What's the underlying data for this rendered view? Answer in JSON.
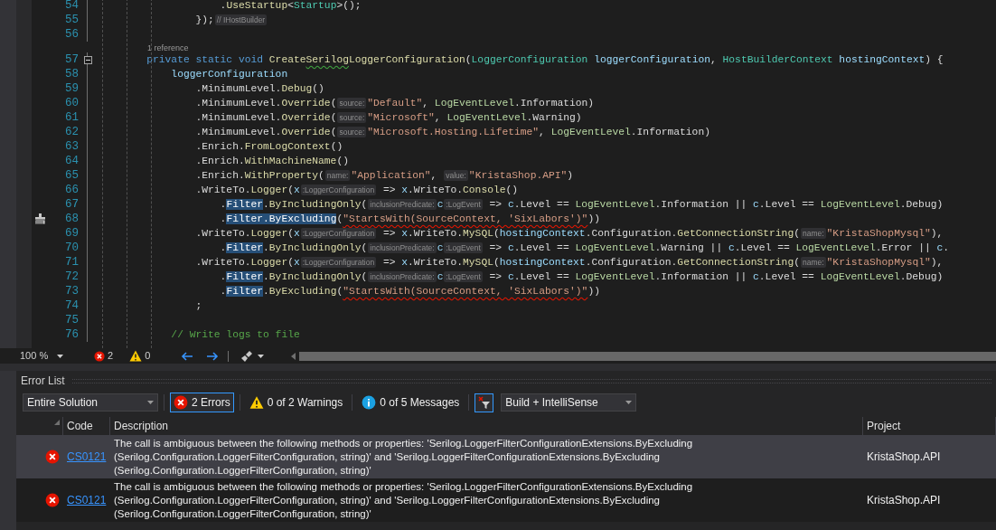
{
  "editor": {
    "lines": [
      {
        "kind": "code",
        "number": "54",
        "fold": false,
        "quick_action": false,
        "tokens": [
          {
            "kind": "plain",
            "text": "                    ."
          },
          {
            "kind": "method",
            "text": "UseStartup"
          },
          {
            "kind": "plain",
            "text": "<"
          },
          {
            "kind": "type",
            "text": "Startup"
          },
          {
            "kind": "plain",
            "text": ">();"
          }
        ]
      },
      {
        "kind": "code",
        "number": "55",
        "fold": false,
        "quick_action": false,
        "tokens": [
          {
            "kind": "plain",
            "text": "                });"
          },
          {
            "kind": "hint",
            "text": "// IHostBuilder"
          }
        ]
      },
      {
        "kind": "code",
        "number": "56",
        "fold": false,
        "quick_action": false
      },
      {
        "kind": "lens",
        "text": "1 reference"
      },
      {
        "kind": "code",
        "number": "57",
        "fold": true,
        "quick_action": false,
        "tokens": [
          {
            "kind": "kw",
            "text": "        private static void "
          },
          {
            "kind": "method",
            "text": "Create"
          },
          {
            "kind": "warning_method",
            "text": "Serilog"
          },
          {
            "kind": "method",
            "text": "LoggerConfiguration"
          },
          {
            "kind": "plain",
            "text": "("
          },
          {
            "kind": "type",
            "text": "LoggerConfiguration"
          },
          {
            "kind": "param",
            "text": " loggerConfiguration"
          },
          {
            "kind": "plain",
            "text": ", "
          },
          {
            "kind": "type",
            "text": "HostBuilderContext"
          },
          {
            "kind": "param",
            "text": " hostingContext"
          },
          {
            "kind": "plain",
            "text": ") {"
          }
        ]
      },
      {
        "kind": "code",
        "number": "58",
        "fold": false,
        "quick_action": false,
        "tokens": [
          {
            "kind": "param",
            "text": "            loggerConfiguration"
          }
        ]
      },
      {
        "kind": "code",
        "number": "59",
        "fold": false,
        "quick_action": false,
        "tokens": [
          {
            "kind": "plain",
            "text": "                .MinimumLevel."
          },
          {
            "kind": "method",
            "text": "Debug"
          },
          {
            "kind": "plain",
            "text": "()"
          }
        ]
      },
      {
        "kind": "code",
        "number": "60",
        "fold": false,
        "quick_action": false,
        "tokens": [
          {
            "kind": "plain",
            "text": "                .MinimumLevel."
          },
          {
            "kind": "method",
            "text": "Override"
          },
          {
            "kind": "plain",
            "text": "("
          },
          {
            "kind": "hint",
            "text": "source:"
          },
          {
            "kind": "str",
            "text": "\"Default\""
          },
          {
            "kind": "plain",
            "text": ", "
          },
          {
            "kind": "enum",
            "text": "LogEventLevel"
          },
          {
            "kind": "plain",
            "text": ".Information)"
          }
        ]
      },
      {
        "kind": "code",
        "number": "61",
        "fold": false,
        "quick_action": false,
        "tokens": [
          {
            "kind": "plain",
            "text": "                .MinimumLevel."
          },
          {
            "kind": "method",
            "text": "Override"
          },
          {
            "kind": "plain",
            "text": "("
          },
          {
            "kind": "hint",
            "text": "source:"
          },
          {
            "kind": "str",
            "text": "\"Microsoft\""
          },
          {
            "kind": "plain",
            "text": ", "
          },
          {
            "kind": "enum",
            "text": "LogEventLevel"
          },
          {
            "kind": "plain",
            "text": ".Warning)"
          }
        ]
      },
      {
        "kind": "code",
        "number": "62",
        "fold": false,
        "quick_action": false,
        "tokens": [
          {
            "kind": "plain",
            "text": "                .MinimumLevel."
          },
          {
            "kind": "method",
            "text": "Override"
          },
          {
            "kind": "plain",
            "text": "("
          },
          {
            "kind": "hint",
            "text": "source:"
          },
          {
            "kind": "str",
            "text": "\"Microsoft.Hosting.Lifetime\""
          },
          {
            "kind": "plain",
            "text": ", "
          },
          {
            "kind": "enum",
            "text": "LogEventLevel"
          },
          {
            "kind": "plain",
            "text": ".Information)"
          }
        ]
      },
      {
        "kind": "code",
        "number": "63",
        "fold": false,
        "quick_action": false,
        "tokens": [
          {
            "kind": "plain",
            "text": "                .Enrich."
          },
          {
            "kind": "method",
            "text": "FromLogContext"
          },
          {
            "kind": "plain",
            "text": "()"
          }
        ]
      },
      {
        "kind": "code",
        "number": "64",
        "fold": false,
        "quick_action": false,
        "tokens": [
          {
            "kind": "plain",
            "text": "                .Enrich."
          },
          {
            "kind": "method",
            "text": "WithMachineName"
          },
          {
            "kind": "plain",
            "text": "()"
          }
        ]
      },
      {
        "kind": "code",
        "number": "65",
        "fold": false,
        "quick_action": false,
        "tokens": [
          {
            "kind": "plain",
            "text": "                .Enrich."
          },
          {
            "kind": "method",
            "text": "WithProperty"
          },
          {
            "kind": "plain",
            "text": "("
          },
          {
            "kind": "hint",
            "text": "name:"
          },
          {
            "kind": "str",
            "text": "\"Application\""
          },
          {
            "kind": "plain",
            "text": ", "
          },
          {
            "kind": "hint",
            "text": "value:"
          },
          {
            "kind": "str",
            "text": "\"KristaShop.API\""
          },
          {
            "kind": "plain",
            "text": ")"
          }
        ]
      },
      {
        "kind": "code",
        "number": "66",
        "fold": false,
        "quick_action": false,
        "tokens": [
          {
            "kind": "plain",
            "text": "                .WriteTo."
          },
          {
            "kind": "method",
            "text": "Logger"
          },
          {
            "kind": "plain",
            "text": "("
          },
          {
            "kind": "param",
            "text": "x"
          },
          {
            "kind": "hint",
            "text": ":LoggerConfiguration"
          },
          {
            "kind": "plain",
            "text": " => "
          },
          {
            "kind": "param",
            "text": "x"
          },
          {
            "kind": "plain",
            "text": ".WriteTo."
          },
          {
            "kind": "method",
            "text": "Console"
          },
          {
            "kind": "plain",
            "text": "()"
          }
        ]
      },
      {
        "kind": "code",
        "number": "67",
        "fold": false,
        "quick_action": false,
        "tokens": [
          {
            "kind": "plain",
            "text": "                    ."
          },
          {
            "kind": "highlight",
            "text": "Filter"
          },
          {
            "kind": "plain",
            "text": "."
          },
          {
            "kind": "method",
            "text": "ByIncludingOnly"
          },
          {
            "kind": "plain",
            "text": "("
          },
          {
            "kind": "hint",
            "text": "inclusionPredicate:"
          },
          {
            "kind": "param",
            "text": "c"
          },
          {
            "kind": "hint",
            "text": ":LogEvent"
          },
          {
            "kind": "plain",
            "text": " => "
          },
          {
            "kind": "param",
            "text": "c"
          },
          {
            "kind": "plain",
            "text": ".Level == "
          },
          {
            "kind": "enum",
            "text": "LogEventLevel"
          },
          {
            "kind": "plain",
            "text": ".Information || "
          },
          {
            "kind": "param",
            "text": "c"
          },
          {
            "kind": "plain",
            "text": ".Level == "
          },
          {
            "kind": "enum",
            "text": "LogEventLevel"
          },
          {
            "kind": "plain",
            "text": ".Debug)"
          }
        ]
      },
      {
        "kind": "code",
        "number": "68",
        "fold": false,
        "quick_action": true,
        "tokens": [
          {
            "kind": "plain",
            "text": "                    ."
          },
          {
            "kind": "highlight",
            "text": "Filter"
          },
          {
            "kind": "highlight",
            "text": ".ByExcluding"
          },
          {
            "kind": "plain",
            "text": "("
          },
          {
            "kind": "error_str",
            "text": "\"StartsWith(SourceContext, 'SixLabors')\""
          },
          {
            "kind": "plain",
            "text": "))"
          }
        ]
      },
      {
        "kind": "code",
        "number": "69",
        "fold": false,
        "quick_action": false,
        "tokens": [
          {
            "kind": "plain",
            "text": "                .WriteTo."
          },
          {
            "kind": "method",
            "text": "Logger"
          },
          {
            "kind": "plain",
            "text": "("
          },
          {
            "kind": "param",
            "text": "x"
          },
          {
            "kind": "hint",
            "text": ":LoggerConfiguration"
          },
          {
            "kind": "plain",
            "text": " => "
          },
          {
            "kind": "param",
            "text": "x"
          },
          {
            "kind": "plain",
            "text": ".WriteTo."
          },
          {
            "kind": "method",
            "text": "MySQL"
          },
          {
            "kind": "plain",
            "text": "("
          },
          {
            "kind": "param",
            "text": "hostingContext"
          },
          {
            "kind": "plain",
            "text": ".Configuration."
          },
          {
            "kind": "method",
            "text": "GetConnectionString"
          },
          {
            "kind": "plain",
            "text": "("
          },
          {
            "kind": "hint",
            "text": "name:"
          },
          {
            "kind": "str",
            "text": "\"KristaShopMysql\""
          },
          {
            "kind": "plain",
            "text": "),"
          }
        ]
      },
      {
        "kind": "code",
        "number": "70",
        "fold": false,
        "quick_action": false,
        "tokens": [
          {
            "kind": "plain",
            "text": "                    ."
          },
          {
            "kind": "highlight",
            "text": "Filter"
          },
          {
            "kind": "plain",
            "text": "."
          },
          {
            "kind": "method",
            "text": "ByIncludingOnly"
          },
          {
            "kind": "plain",
            "text": "("
          },
          {
            "kind": "hint",
            "text": "inclusionPredicate:"
          },
          {
            "kind": "param",
            "text": "c"
          },
          {
            "kind": "hint",
            "text": ":LogEvent"
          },
          {
            "kind": "plain",
            "text": " => "
          },
          {
            "kind": "param",
            "text": "c"
          },
          {
            "kind": "plain",
            "text": ".Level == "
          },
          {
            "kind": "enum",
            "text": "LogEventLevel"
          },
          {
            "kind": "plain",
            "text": ".Warning || "
          },
          {
            "kind": "param",
            "text": "c"
          },
          {
            "kind": "plain",
            "text": ".Level == "
          },
          {
            "kind": "enum",
            "text": "LogEventLevel"
          },
          {
            "kind": "plain",
            "text": ".Error || "
          },
          {
            "kind": "param",
            "text": "c"
          },
          {
            "kind": "plain",
            "text": "."
          }
        ]
      },
      {
        "kind": "code",
        "number": "71",
        "fold": false,
        "quick_action": false,
        "tokens": [
          {
            "kind": "plain",
            "text": "                .WriteTo."
          },
          {
            "kind": "method",
            "text": "Logger"
          },
          {
            "kind": "plain",
            "text": "("
          },
          {
            "kind": "param",
            "text": "x"
          },
          {
            "kind": "hint",
            "text": ":LoggerConfiguration"
          },
          {
            "kind": "plain",
            "text": " => "
          },
          {
            "kind": "param",
            "text": "x"
          },
          {
            "kind": "plain",
            "text": ".WriteTo."
          },
          {
            "kind": "method",
            "text": "MySQL"
          },
          {
            "kind": "plain",
            "text": "("
          },
          {
            "kind": "param",
            "text": "hostingContext"
          },
          {
            "kind": "plain",
            "text": ".Configuration."
          },
          {
            "kind": "method",
            "text": "GetConnectionString"
          },
          {
            "kind": "plain",
            "text": "("
          },
          {
            "kind": "hint",
            "text": "name:"
          },
          {
            "kind": "str",
            "text": "\"KristaShopMysql\""
          },
          {
            "kind": "plain",
            "text": "),"
          }
        ]
      },
      {
        "kind": "code",
        "number": "72",
        "fold": false,
        "quick_action": false,
        "tokens": [
          {
            "kind": "plain",
            "text": "                    ."
          },
          {
            "kind": "highlight",
            "text": "Filter"
          },
          {
            "kind": "plain",
            "text": "."
          },
          {
            "kind": "method",
            "text": "ByIncludingOnly"
          },
          {
            "kind": "plain",
            "text": "("
          },
          {
            "kind": "hint",
            "text": "inclusionPredicate:"
          },
          {
            "kind": "param",
            "text": "c"
          },
          {
            "kind": "hint",
            "text": ":LogEvent"
          },
          {
            "kind": "plain",
            "text": " => "
          },
          {
            "kind": "param",
            "text": "c"
          },
          {
            "kind": "plain",
            "text": ".Level == "
          },
          {
            "kind": "enum",
            "text": "LogEventLevel"
          },
          {
            "kind": "plain",
            "text": ".Information || "
          },
          {
            "kind": "param",
            "text": "c"
          },
          {
            "kind": "plain",
            "text": ".Level == "
          },
          {
            "kind": "enum",
            "text": "LogEventLevel"
          },
          {
            "kind": "plain",
            "text": ".Debug)"
          }
        ]
      },
      {
        "kind": "code",
        "number": "73",
        "fold": false,
        "quick_action": false,
        "tokens": [
          {
            "kind": "plain",
            "text": "                    ."
          },
          {
            "kind": "highlight",
            "text": "Filter"
          },
          {
            "kind": "plain",
            "text": "."
          },
          {
            "kind": "method",
            "text": "ByExcluding"
          },
          {
            "kind": "plain",
            "text": "("
          },
          {
            "kind": "error_str",
            "text": "\"StartsWith(SourceContext, 'SixLabors')\""
          },
          {
            "kind": "plain",
            "text": "))"
          }
        ]
      },
      {
        "kind": "code",
        "number": "74",
        "fold": false,
        "quick_action": false,
        "tokens": [
          {
            "kind": "plain",
            "text": "                ;"
          }
        ]
      },
      {
        "kind": "code",
        "number": "75",
        "fold": false,
        "quick_action": false
      },
      {
        "kind": "code",
        "number": "76",
        "fold": false,
        "quick_action": false,
        "tokens": [
          {
            "kind": "comment",
            "text": "            // Write logs to file"
          }
        ]
      }
    ]
  },
  "status_bar": {
    "zoom": "100 %",
    "errors": "2",
    "warnings": "0"
  },
  "error_list": {
    "title": "Error List",
    "scope": "Entire Solution",
    "filters": [
      {
        "kind": "error",
        "label": "2 Errors",
        "selected": true
      },
      {
        "kind": "warning",
        "label": "0 of 2 Warnings",
        "selected": false
      },
      {
        "kind": "info",
        "label": "0 of 5 Messages",
        "selected": false
      }
    ],
    "clear_filter": {
      "selected": true
    },
    "source": "Build + IntelliSense",
    "columns": [
      "Code",
      "Description",
      "Project"
    ],
    "rows": [
      {
        "code": "CS0121",
        "description": "The call is ambiguous between the following methods or properties: 'Serilog.LoggerFilterConfigurationExtensions.ByExcluding (Serilog.Configuration.LoggerFilterConfiguration, string)' and 'Serilog.LoggerFilterConfigurationExtensions.ByExcluding (Serilog.Configuration.LoggerFilterConfiguration, string)'",
        "project": "KristaShop.API",
        "selected": true
      },
      {
        "code": "CS0121",
        "description": "The call is ambiguous between the following methods or properties: 'Serilog.LoggerFilterConfigurationExtensions.ByExcluding (Serilog.Configuration.LoggerFilterConfiguration, string)' and 'Serilog.LoggerFilterConfigurationExtensions.ByExcluding (Serilog.Configuration.LoggerFilterConfiguration, string)'",
        "project": "KristaShop.API",
        "selected": false
      }
    ]
  }
}
